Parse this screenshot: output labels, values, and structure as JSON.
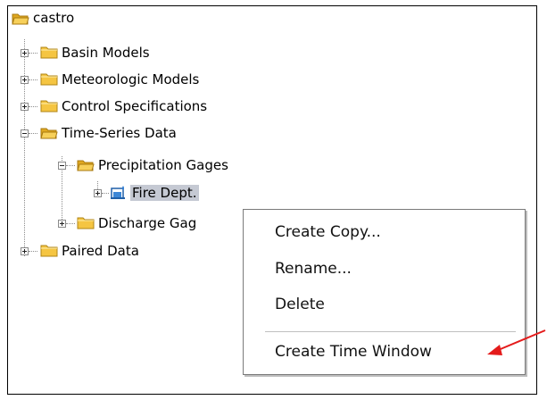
{
  "tree": {
    "root": {
      "label": "castro",
      "icon": "folder-open-icon"
    },
    "items": [
      {
        "label": "Basin Models",
        "icon": "folder-icon",
        "expander": "plus"
      },
      {
        "label": "Meteorologic Models",
        "icon": "folder-icon",
        "expander": "plus"
      },
      {
        "label": "Control Specifications",
        "icon": "folder-icon",
        "expander": "plus"
      },
      {
        "label": "Time-Series Data",
        "icon": "folder-open-icon",
        "expander": "minus",
        "children": [
          {
            "label": "Precipitation Gages",
            "icon": "folder-open-icon",
            "expander": "minus",
            "children": [
              {
                "label": "Fire Dept.",
                "icon": "precipitation-gage-icon",
                "expander": "plus",
                "selected": true
              }
            ]
          },
          {
            "label": "Discharge Gag",
            "icon": "folder-icon",
            "expander": "plus"
          }
        ]
      },
      {
        "label": "Paired Data",
        "icon": "folder-icon",
        "expander": "plus"
      }
    ]
  },
  "context_menu": {
    "items": [
      {
        "label": "Create Copy..."
      },
      {
        "label": "Rename..."
      },
      {
        "label": "Delete"
      },
      {
        "label": "Create Time Window"
      }
    ]
  },
  "annotation": {
    "type": "arrow",
    "color": "#e41b1b",
    "points_to": "Create Time Window"
  },
  "colors": {
    "folder": "#f5c542",
    "folder_dark": "#c9920f",
    "selection": "#c5c9d3"
  }
}
